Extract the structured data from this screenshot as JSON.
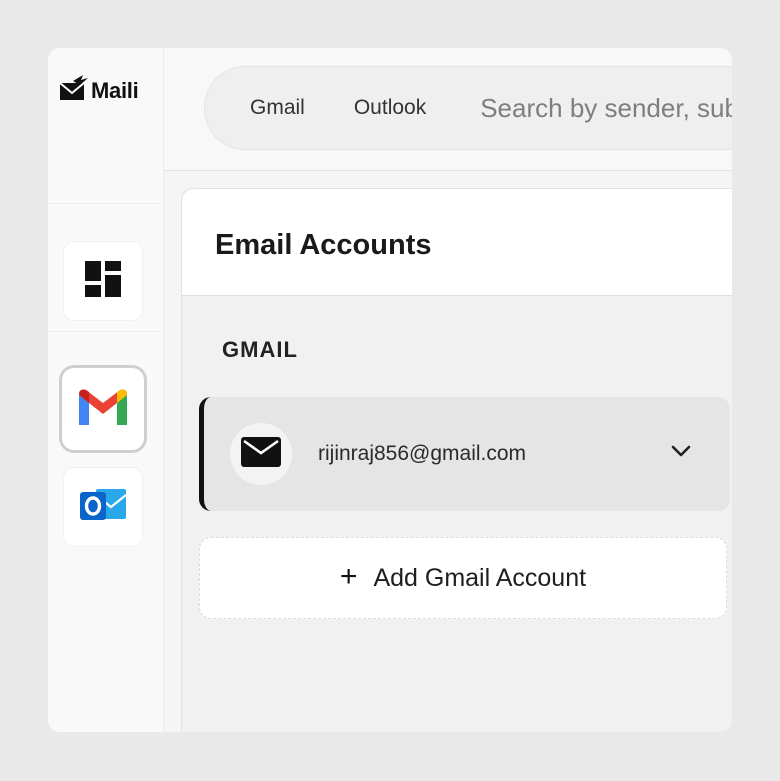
{
  "app": {
    "name": "Maili"
  },
  "nav": {
    "items": [
      {
        "id": "dashboard",
        "icon": "dashboard-icon"
      },
      {
        "id": "gmail",
        "icon": "gmail-icon",
        "active": true
      },
      {
        "id": "outlook",
        "icon": "outlook-icon"
      }
    ]
  },
  "search": {
    "tabs": [
      "Gmail",
      "Outlook"
    ],
    "placeholder": "Search by sender, subject, or keyword"
  },
  "panel": {
    "title": "Email Accounts",
    "section": "GMAIL",
    "accounts": [
      {
        "email": "rijinraj856@gmail.com",
        "icon": "mail-icon"
      }
    ],
    "add_label": "Add Gmail Account"
  },
  "colors": {
    "accent": "#111111",
    "gmail_red": "#EA4335",
    "gmail_blue": "#4285F4",
    "gmail_green": "#34A853",
    "gmail_yellow": "#FBBC04",
    "outlook_blue": "#0A64C9"
  }
}
